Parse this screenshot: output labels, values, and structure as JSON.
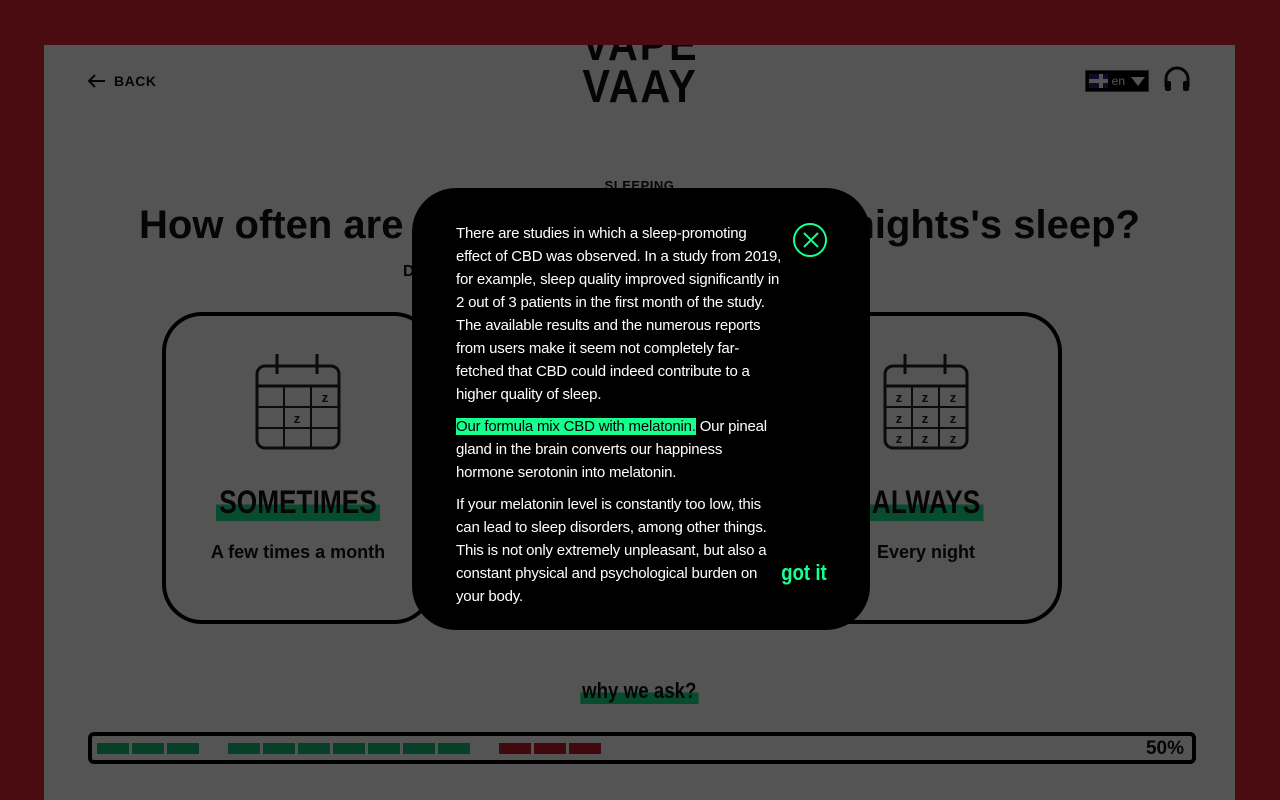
{
  "header": {
    "back_label": "BACK",
    "logo_line1": "VAPE",
    "logo_line2": "VAAY",
    "language_code": "en"
  },
  "question": {
    "eyebrow": "SLEEPING",
    "title_visible_left": "How often are",
    "title_visible_right": "nights's sleep?",
    "subtitle_visible": "D"
  },
  "options": [
    {
      "label": "SOMETIMES",
      "description": "A few times a month",
      "icon": "calendar-sleep-icon",
      "z_marks": 2
    },
    {
      "label": "ALWAYS",
      "description": "Every night",
      "icon": "calendar-sleep-icon",
      "z_marks": 9
    }
  ],
  "why_link": "why we ask?",
  "progress": {
    "percent_label": "50%",
    "value": 0.5,
    "segments": [
      "g",
      "g",
      "g",
      "gap",
      "g",
      "g",
      "g",
      "g",
      "g",
      "g",
      "g",
      "gap",
      "r",
      "r",
      "r"
    ]
  },
  "modal": {
    "paragraph1": "There are studies in which a sleep-promoting effect of CBD was observed. In a study from 2019, for example, sleep quality improved significantly in 2 out of 3 patients in the first month of the study. The available results and the numerous reports from users make it seem not completely far-fetched that CBD could indeed contribute to a higher quality of sleep.",
    "paragraph2_highlight": "Our formula mix CBD with melatonin.",
    "paragraph2_rest": " Our pineal gland in the brain converts our happiness hormone serotonin into melatonin.",
    "paragraph3": "If your melatonin level is constantly too low, this can lead to sleep disorders, among other things. This is not only extremely unpleasant, but also a constant physical and psychological burden on your body.",
    "confirm_label": "got it"
  },
  "colors": {
    "frame": "#4a0b11",
    "accent_green": "#17ff8f",
    "progress_green": "#18c07a",
    "progress_red": "#c41e2a"
  }
}
